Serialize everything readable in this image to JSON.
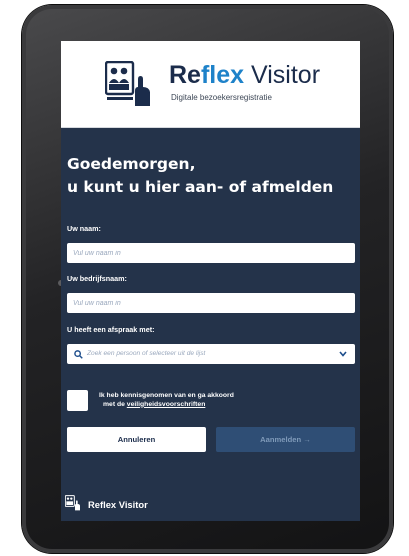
{
  "brand": {
    "name_part1": "Re",
    "name_part2": "flex",
    "name_part3": " Visitor",
    "tagline": "Digitale bezoekersregistratie",
    "logo_icon": "visitor-at-kiosk-icon"
  },
  "greeting": {
    "line1": "Goedemorgen,",
    "line2": "u kunt u hier aan- of afmelden"
  },
  "form": {
    "name_label": "Uw naam:",
    "name_placeholder": "Vul uw naam in",
    "name_value": "",
    "company_label": "Uw bedrijfsnaam:",
    "company_placeholder": "Vul uw naam in",
    "company_value": "",
    "appointment_label": "U heeft een afspraak met:",
    "appointment_placeholder": "Zoek een persoon of selecteer uit de lijst",
    "consent_line1": "Ik heb kennisgenomen van en ga akkoord",
    "consent_prefix": "met de ",
    "consent_link": "veiligheidsvoorschriften",
    "consent_checked": false
  },
  "buttons": {
    "cancel": "Annuleren",
    "submit": "Aanmelden →"
  },
  "footer": {
    "name": "Reflex Visitor",
    "logo_icon": "visitor-at-kiosk-icon"
  },
  "colors": {
    "screen_bg": "#24334a",
    "brand_blue": "#1e82c9",
    "brand_navy": "#1b2c4b",
    "disabled_button": "#2f4e75"
  }
}
